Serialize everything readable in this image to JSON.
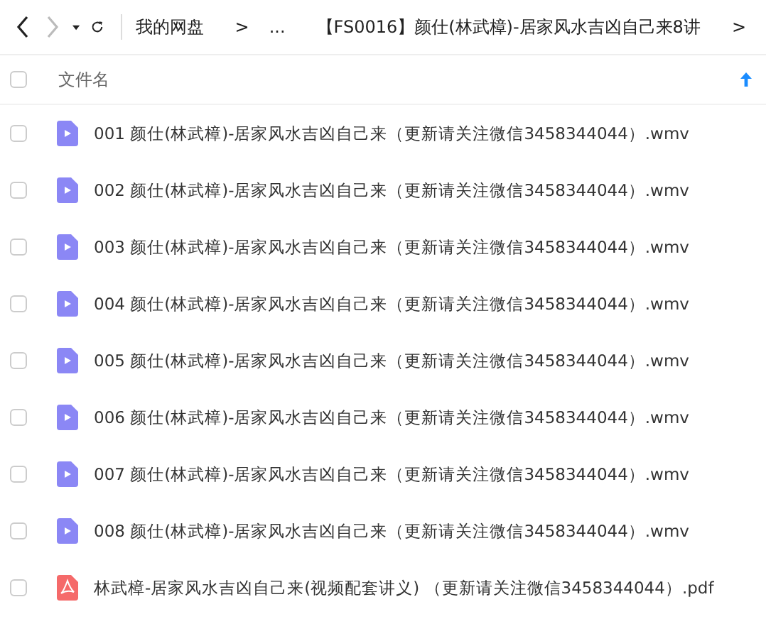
{
  "toolbar": {
    "back": {
      "disabled": false
    },
    "forward": {
      "disabled": true
    }
  },
  "breadcrumb": [
    {
      "kind": "link",
      "text": "我的网盘"
    },
    {
      "kind": "separator",
      "text": ">"
    },
    {
      "kind": "link",
      "text": "..."
    },
    {
      "kind": "link",
      "text": "【FS0016】颜仕(林武樟)-居家风水吉凶自己来8讲"
    },
    {
      "kind": "separator",
      "text": ">"
    }
  ],
  "header": {
    "checked": false,
    "column": "文件名"
  },
  "files": [
    {
      "kind": "video",
      "checked": false,
      "name": "001 颜仕(林武樟)-居家风水吉凶自己来（更新请关注微信3458344044）.wmv"
    },
    {
      "kind": "video",
      "checked": false,
      "name": "002 颜仕(林武樟)-居家风水吉凶自己来（更新请关注微信3458344044）.wmv"
    },
    {
      "kind": "video",
      "checked": false,
      "name": "003 颜仕(林武樟)-居家风水吉凶自己来（更新请关注微信3458344044）.wmv"
    },
    {
      "kind": "video",
      "checked": false,
      "name": "004 颜仕(林武樟)-居家风水吉凶自己来（更新请关注微信3458344044）.wmv"
    },
    {
      "kind": "video",
      "checked": false,
      "name": "005 颜仕(林武樟)-居家风水吉凶自己来（更新请关注微信3458344044）.wmv"
    },
    {
      "kind": "video",
      "checked": false,
      "name": "006 颜仕(林武樟)-居家风水吉凶自己来（更新请关注微信3458344044）.wmv"
    },
    {
      "kind": "video",
      "checked": false,
      "name": "007 颜仕(林武樟)-居家风水吉凶自己来（更新请关注微信3458344044）.wmv"
    },
    {
      "kind": "video",
      "checked": false,
      "name": "008 颜仕(林武樟)-居家风水吉凶自己来（更新请关注微信3458344044）.wmv"
    },
    {
      "kind": "pdf",
      "checked": false,
      "name": "林武樟-居家风水吉凶自己来(视频配套讲义) （更新请关注微信3458344044）.pdf"
    }
  ]
}
